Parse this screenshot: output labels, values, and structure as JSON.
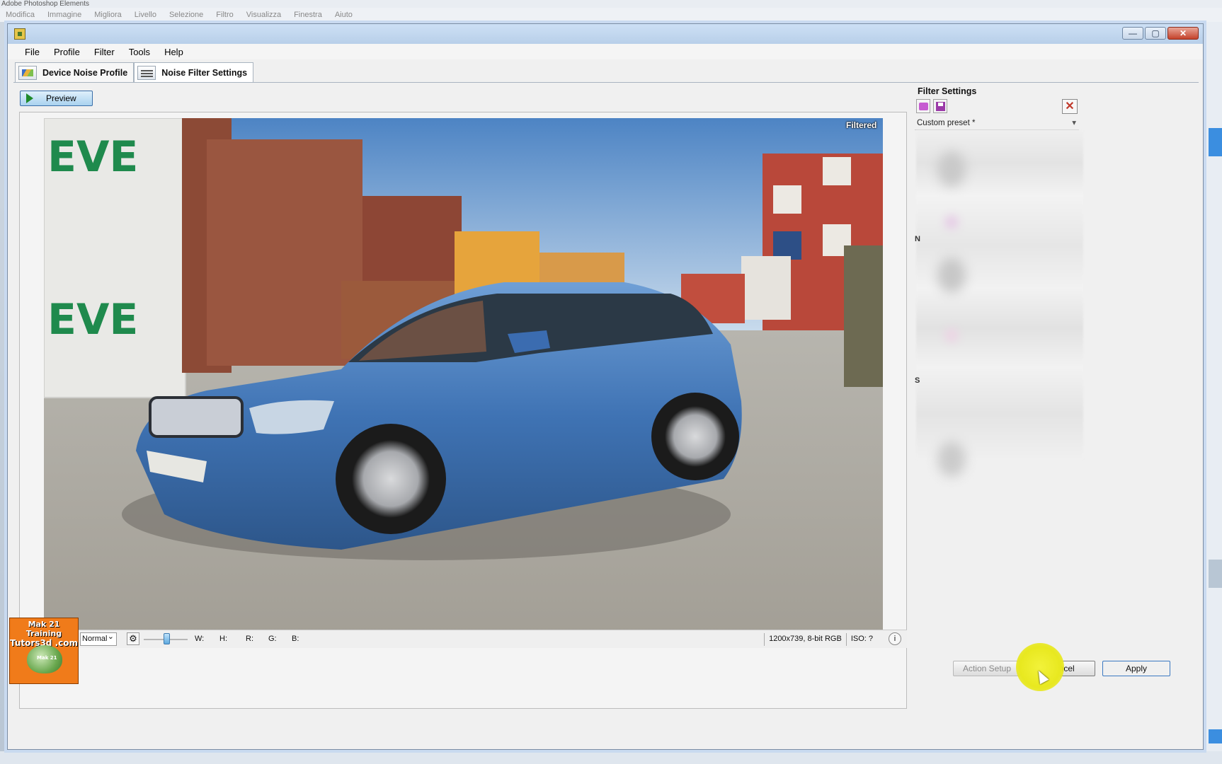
{
  "host": {
    "title": "Adobe Photoshop Elements",
    "menu": [
      "Modifica",
      "Immagine",
      "Migliora",
      "Livello",
      "Selezione",
      "Filtro",
      "Visualizza",
      "Finestra",
      "Aiuto"
    ]
  },
  "window": {
    "controls": {
      "minimize": "—",
      "maximize": "▢",
      "close": "✕"
    }
  },
  "menubar": [
    "File",
    "Profile",
    "Filter",
    "Tools",
    "Help"
  ],
  "tabs": [
    {
      "label": "Device Noise Profile",
      "icon": "graph-icon",
      "active": false
    },
    {
      "label": "Noise Filter Settings",
      "icon": "sliders-icon",
      "active": true
    }
  ],
  "preview_button": "Preview",
  "viewer": {
    "badge": "Filtered"
  },
  "statusbar": {
    "mode": "Normal",
    "w_label": "W:",
    "h_label": "H:",
    "r_label": "R:",
    "g_label": "G:",
    "b_label": "B:",
    "image_info": "1200x739, 8-bit RGB",
    "iso": "ISO: ?",
    "info_icon": "i"
  },
  "filter_settings": {
    "title": "Filter Settings",
    "preset": "Custom preset *",
    "side_chars": [
      "N",
      "S"
    ]
  },
  "buttons": {
    "action_setup": "Action Setup",
    "cancel": "Cancel",
    "apply": "Apply"
  },
  "logo": {
    "line1": "Mak 21 Training",
    "line2": "Tutors3d .com",
    "pot_label": "Mak 21"
  }
}
